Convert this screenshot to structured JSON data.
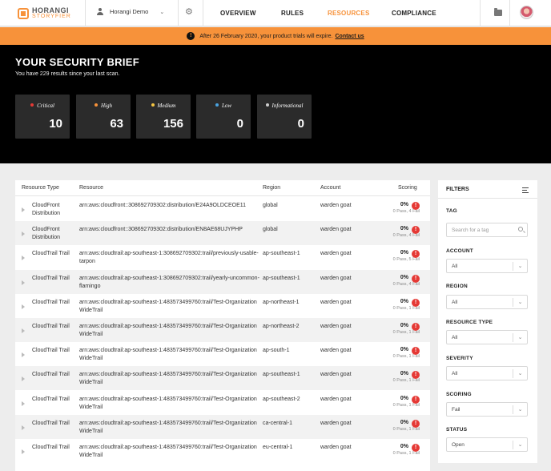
{
  "brand": {
    "line1": "HORANGI",
    "line2": "STORYFIER"
  },
  "account": {
    "name": "Horangi Demo"
  },
  "nav": {
    "overview": "OVERVIEW",
    "rules": "RULES",
    "resources": "RESOURCES",
    "compliance": "COMPLIANCE",
    "active": "resources"
  },
  "banner": {
    "text": "After 26 February 2020, your product trials will expire.",
    "link": "Contact us"
  },
  "hero": {
    "title": "YOUR SECURITY BRIEF",
    "subtitle": "You have 229 results since your last scan.",
    "cards": [
      {
        "label": "Critical",
        "value": "10",
        "color": "#e53935"
      },
      {
        "label": "High",
        "value": "63",
        "color": "#f7923a"
      },
      {
        "label": "Medium",
        "value": "156",
        "color": "#f5c542"
      },
      {
        "label": "Low",
        "value": "0",
        "color": "#4aa3df"
      },
      {
        "label": "Informational",
        "value": "0",
        "color": "#cccccc"
      }
    ]
  },
  "table": {
    "headers": {
      "type": "Resource Type",
      "resource": "Resource",
      "region": "Region",
      "account": "Account",
      "scoring": "Scoring"
    },
    "rows": [
      {
        "type": "CloudFront Distribution",
        "resource": "arn:aws:cloudfront::308692709302:distribution/E24A9OLDCEOE11",
        "region": "global",
        "account": "warden goat",
        "score": "0%",
        "pf": "0 Pass, 4 Fail"
      },
      {
        "type": "CloudFront Distribution",
        "resource": "arn:aws:cloudfront::308692709302:distribution/EN8AE68UJYPHP",
        "region": "global",
        "account": "warden goat",
        "score": "0%",
        "pf": "0 Pass, 4 Fail"
      },
      {
        "type": "CloudTrail Trail",
        "resource": "arn:aws:cloudtrail:ap-southeast-1:308692709302:trail/previously-usable-tarpon",
        "region": "ap-southeast-1",
        "account": "warden goat",
        "score": "0%",
        "pf": "0 Pass, 5 Fail"
      },
      {
        "type": "CloudTrail Trail",
        "resource": "arn:aws:cloudtrail:ap-southeast-1:308692709302:trail/yearly-uncommon-flamingo",
        "region": "ap-southeast-1",
        "account": "warden goat",
        "score": "0%",
        "pf": "0 Pass, 4 Fail"
      },
      {
        "type": "CloudTrail Trail",
        "resource": "arn:aws:cloudtrail:ap-southeast-1:483573499760:trail/Test-OrganizationWideTrail",
        "region": "ap-northeast-1",
        "account": "warden goat",
        "score": "0%",
        "pf": "0 Pass, 1 Fail"
      },
      {
        "type": "CloudTrail Trail",
        "resource": "arn:aws:cloudtrail:ap-southeast-1:483573499760:trail/Test-OrganizationWideTrail",
        "region": "ap-northeast-2",
        "account": "warden goat",
        "score": "0%",
        "pf": "0 Pass, 1 Fail"
      },
      {
        "type": "CloudTrail Trail",
        "resource": "arn:aws:cloudtrail:ap-southeast-1:483573499760:trail/Test-OrganizationWideTrail",
        "region": "ap-south-1",
        "account": "warden goat",
        "score": "0%",
        "pf": "0 Pass, 1 Fail"
      },
      {
        "type": "CloudTrail Trail",
        "resource": "arn:aws:cloudtrail:ap-southeast-1:483573499760:trail/Test-OrganizationWideTrail",
        "region": "ap-southeast-1",
        "account": "warden goat",
        "score": "0%",
        "pf": "0 Pass, 1 Fail"
      },
      {
        "type": "CloudTrail Trail",
        "resource": "arn:aws:cloudtrail:ap-southeast-1:483573499760:trail/Test-OrganizationWideTrail",
        "region": "ap-southeast-2",
        "account": "warden goat",
        "score": "0%",
        "pf": "0 Pass, 1 Fail"
      },
      {
        "type": "CloudTrail Trail",
        "resource": "arn:aws:cloudtrail:ap-southeast-1:483573499760:trail/Test-OrganizationWideTrail",
        "region": "ca-central-1",
        "account": "warden goat",
        "score": "0%",
        "pf": "0 Pass, 1 Fail"
      },
      {
        "type": "CloudTrail Trail",
        "resource": "arn:aws:cloudtrail:ap-southeast-1:483573499760:trail/Test-OrganizationWideTrail",
        "region": "eu-central-1",
        "account": "warden goat",
        "score": "0%",
        "pf": "0 Pass, 1 Fail"
      }
    ]
  },
  "filters": {
    "title": "FILTERS",
    "tag": {
      "label": "TAG",
      "placeholder": "Search for a tag"
    },
    "account": {
      "label": "ACCOUNT",
      "value": "All"
    },
    "region": {
      "label": "REGION",
      "value": "All"
    },
    "resource_type": {
      "label": "RESOURCE TYPE",
      "value": "All"
    },
    "severity": {
      "label": "SEVERITY",
      "value": "All"
    },
    "scoring": {
      "label": "SCORING",
      "value": "Fail"
    },
    "status": {
      "label": "STATUS",
      "value": "Open"
    }
  }
}
